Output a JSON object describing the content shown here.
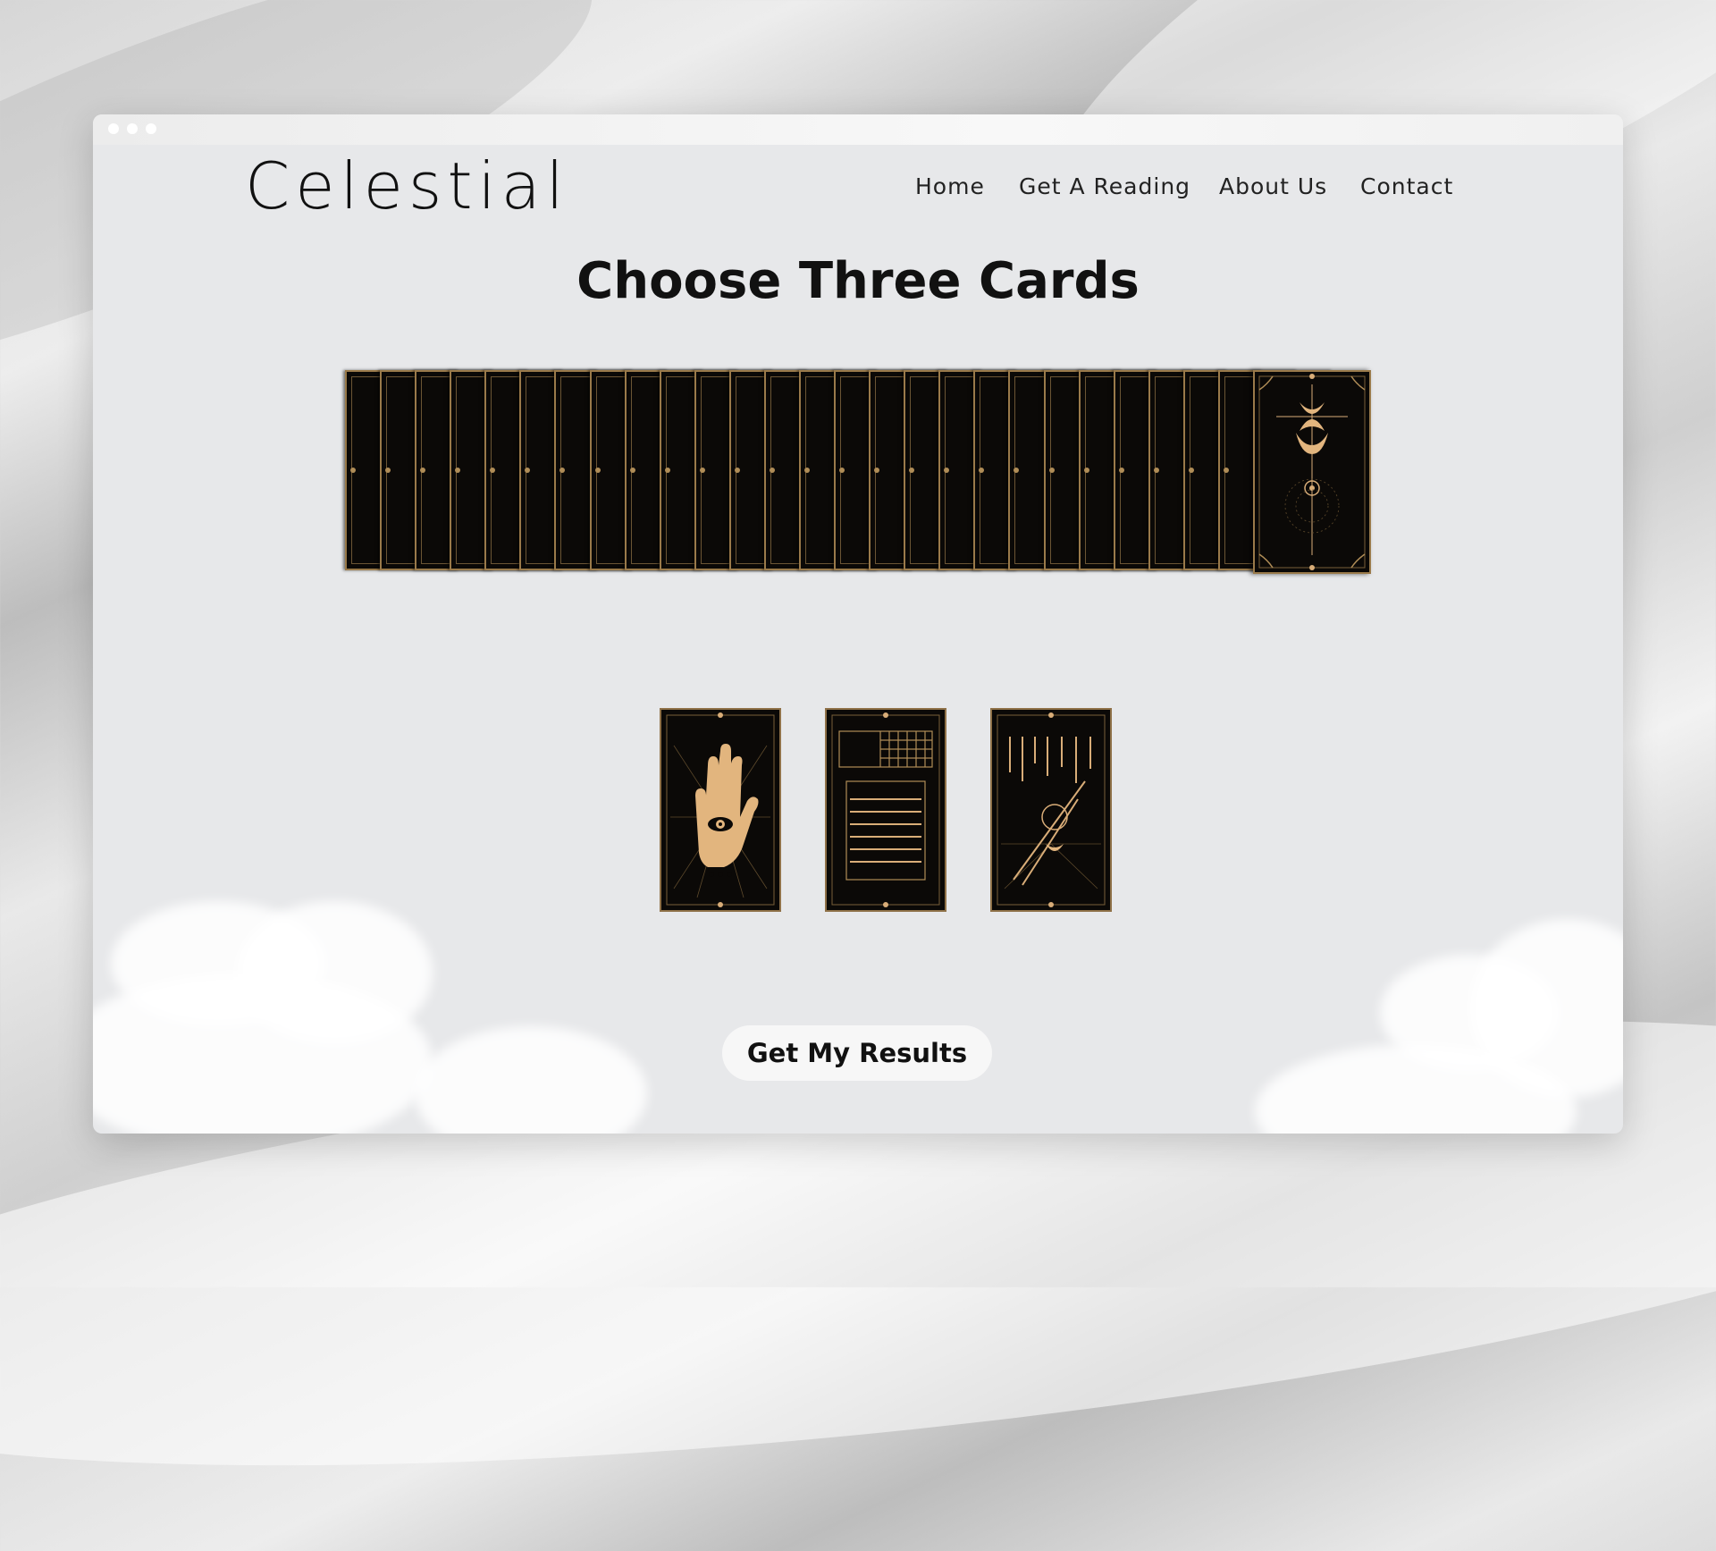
{
  "brand": {
    "name": "Celestial"
  },
  "nav": {
    "items": [
      {
        "label": "Home"
      },
      {
        "label": "Get A Reading"
      },
      {
        "label": "About Us"
      },
      {
        "label": "Contact"
      }
    ]
  },
  "main": {
    "title": "Choose Three Cards",
    "deck": {
      "face_down_count": 26
    },
    "selected_cards": [
      {
        "icon": "palm-eye-icon"
      },
      {
        "icon": "cage-icon"
      },
      {
        "icon": "swords-icon"
      }
    ],
    "results_button": {
      "label": "Get My Results"
    }
  },
  "colors": {
    "gold": "#d9ad78",
    "card_black": "#0b0907",
    "window_bg": "#e7e8ea"
  }
}
